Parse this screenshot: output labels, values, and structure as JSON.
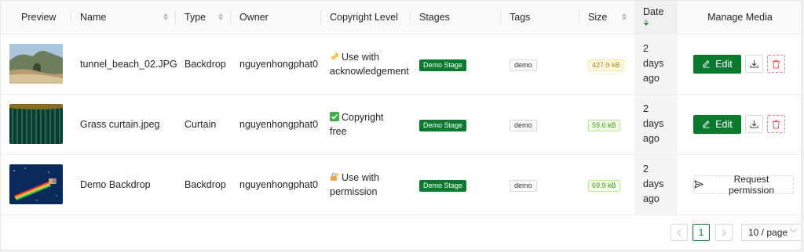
{
  "columns": {
    "preview": "Preview",
    "name": "Name",
    "type": "Type",
    "owner": "Owner",
    "copyright": "Copyright Level",
    "stages": "Stages",
    "tags": "Tags",
    "size": "Size",
    "date": "Date",
    "manage": "Manage Media"
  },
  "rows": [
    {
      "name": "tunnel_beach_02.JPG",
      "type": "Backdrop",
      "owner": "nguyenhongphat0",
      "copyright": "Use with acknowledgement",
      "copyright_icon": "ok-hand-icon",
      "stage": "Demo Stage",
      "tag": "demo",
      "size": "427.9 kB",
      "size_status": "warning",
      "date": "2 days ago",
      "edit_label": "Edit"
    },
    {
      "name": "Grass curtain.jpeg",
      "type": "Curtain",
      "owner": "nguyenhongphat0",
      "copyright": "Copyright free",
      "copyright_icon": "check-mark-icon",
      "stage": "Demo Stage",
      "tag": "demo",
      "size": "59.6 kB",
      "size_status": "ok",
      "date": "2 days ago",
      "edit_label": "Edit"
    },
    {
      "name": "Demo Backdrop",
      "type": "Backdrop",
      "owner": "nguyenhongphat0",
      "copyright": "Use with permission",
      "copyright_icon": "lock-key-icon",
      "stage": "Demo Stage",
      "tag": "demo",
      "size": "69.9 kB",
      "size_status": "ok",
      "date": "2 days ago",
      "request_label": "Request permission"
    }
  ],
  "pagination": {
    "current_page": "1",
    "page_size": "10 / page"
  },
  "colors": {
    "primary": "#0a7a2e",
    "danger": "#ff4d4f",
    "warning_text": "#c27a00",
    "success_text": "#389e0d"
  }
}
